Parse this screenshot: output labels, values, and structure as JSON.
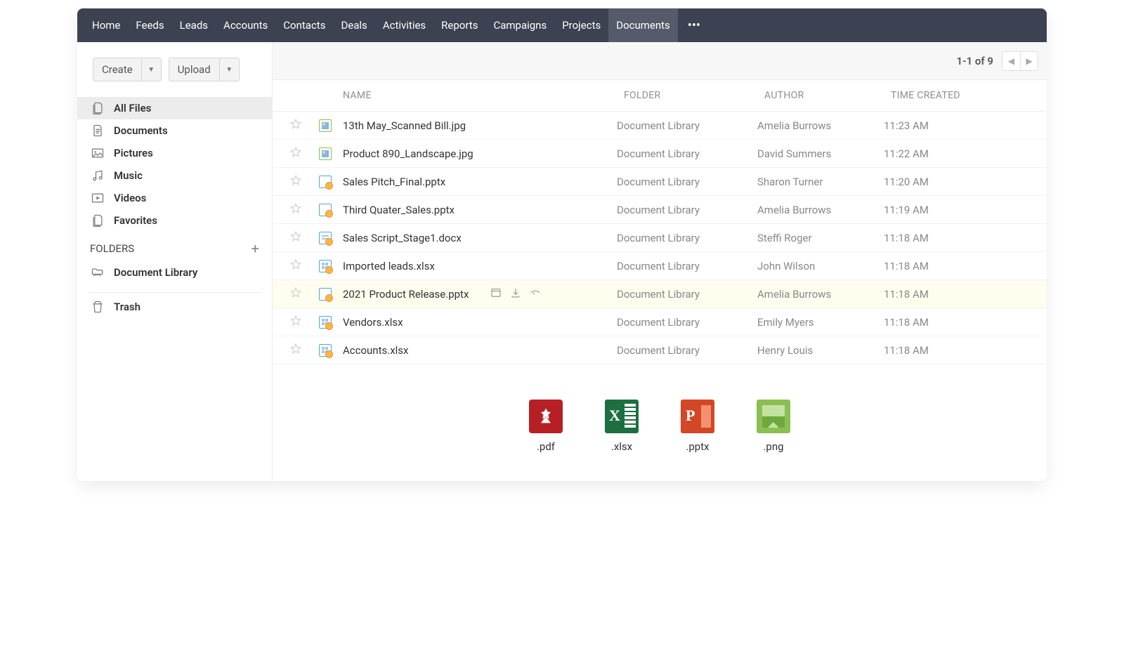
{
  "nav": {
    "items": [
      "Home",
      "Feeds",
      "Leads",
      "Accounts",
      "Contacts",
      "Deals",
      "Activities",
      "Reports",
      "Campaigns",
      "Projects",
      "Documents"
    ],
    "selectedIndex": 10
  },
  "sidebar": {
    "create_label": "Create",
    "upload_label": "Upload",
    "categories": [
      {
        "label": "All Files",
        "icon": "files",
        "selected": true
      },
      {
        "label": "Documents",
        "icon": "doc",
        "selected": false
      },
      {
        "label": "Pictures",
        "icon": "image",
        "selected": false
      },
      {
        "label": "Music",
        "icon": "music",
        "selected": false
      },
      {
        "label": "Videos",
        "icon": "video",
        "selected": false
      },
      {
        "label": "Favorites",
        "icon": "files",
        "selected": false
      }
    ],
    "folders_header": "FOLDERS",
    "folders": [
      {
        "label": "Document Library",
        "icon": "folder-hand"
      }
    ],
    "trash_label": "Trash"
  },
  "toolbar": {
    "pager": "1-1 of 9"
  },
  "table": {
    "headers": {
      "name": "NAME",
      "folder": "FOLDER",
      "author": "AUTHOR",
      "time": "TIME CREATED"
    },
    "rows": [
      {
        "name": "13th May_Scanned Bill.jpg",
        "type": "img",
        "folder": "Document Library",
        "author": "Amelia Burrows",
        "time": "11:23 AM",
        "highlight": false
      },
      {
        "name": "Product 890_Landscape.jpg",
        "type": "img",
        "folder": "Document Library",
        "author": "David Summers",
        "time": "11:22 AM",
        "highlight": false
      },
      {
        "name": "Sales Pitch_Final.pptx",
        "type": "pptx",
        "folder": "Document Library",
        "author": "Sharon Turner",
        "time": "11:20 AM",
        "highlight": false
      },
      {
        "name": "Third Quater_Sales.pptx",
        "type": "pptx",
        "folder": "Document Library",
        "author": "Amelia Burrows",
        "time": "11:19 AM",
        "highlight": false
      },
      {
        "name": "Sales Script_Stage1.docx",
        "type": "docx",
        "folder": "Document Library",
        "author": "Steffi Roger",
        "time": "11:18 AM",
        "highlight": false
      },
      {
        "name": "Imported leads.xlsx",
        "type": "xlsx",
        "folder": "Document Library",
        "author": "John Wilson",
        "time": "11:18 AM",
        "highlight": false
      },
      {
        "name": "2021 Product Release.pptx",
        "type": "pptx",
        "folder": "Document Library",
        "author": "Amelia Burrows",
        "time": "11:18 AM",
        "highlight": true
      },
      {
        "name": "Vendors.xlsx",
        "type": "xlsx",
        "folder": "Document Library",
        "author": "Emily Myers",
        "time": "11:18 AM",
        "highlight": false
      },
      {
        "name": "Accounts.xlsx",
        "type": "xlsx",
        "folder": "Document Library",
        "author": "Henry Louis",
        "time": "11:18 AM",
        "highlight": false
      }
    ]
  },
  "formats": [
    {
      "ext": ".pdf",
      "kind": "pdf"
    },
    {
      "ext": ".xlsx",
      "kind": "xlsx"
    },
    {
      "ext": ".pptx",
      "kind": "pptx"
    },
    {
      "ext": ".png",
      "kind": "png"
    }
  ]
}
